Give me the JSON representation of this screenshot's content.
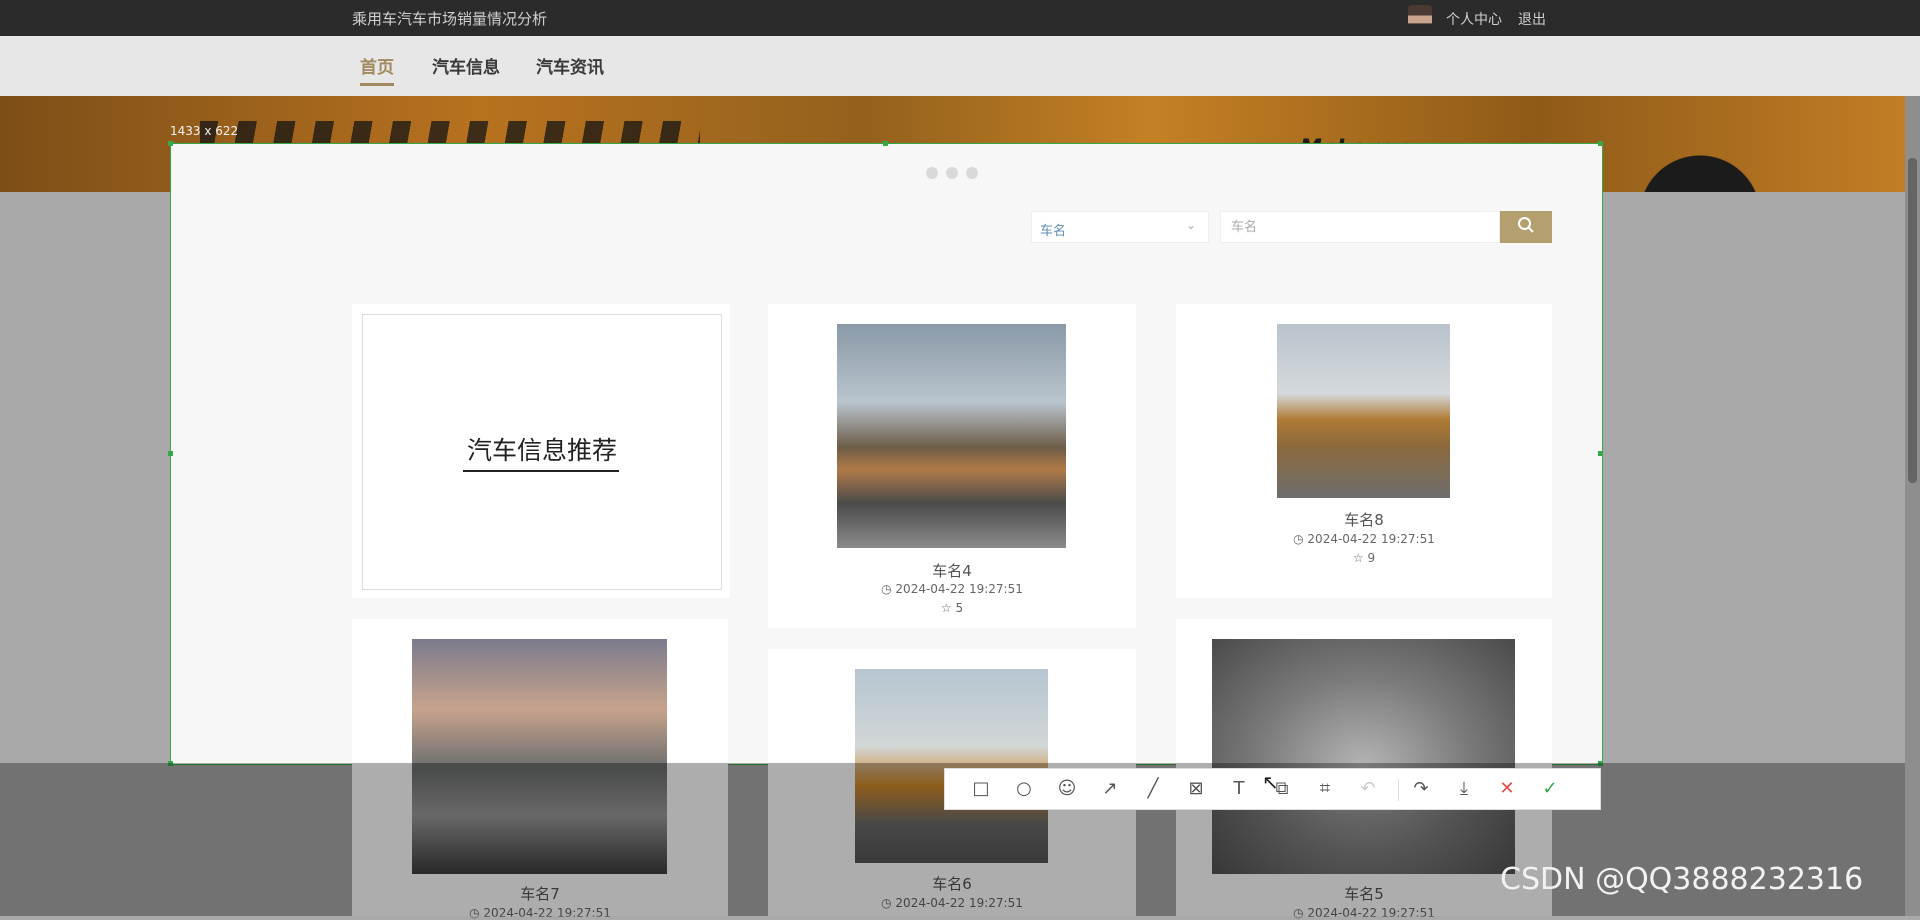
{
  "header": {
    "site_title": "乘用车汽车市场销量情况分析",
    "user_center": "个人中心",
    "logout": "退出"
  },
  "nav": {
    "items": [
      {
        "label": "首页",
        "active": true
      },
      {
        "label": "汽车信息",
        "active": false
      },
      {
        "label": "汽车资讯",
        "active": false
      }
    ]
  },
  "banner": {
    "brand_text": "McLaren"
  },
  "selection": {
    "size_label": "1433 x 622"
  },
  "search": {
    "field_select_value": "车名",
    "input_placeholder": "车名"
  },
  "recommend": {
    "title": "汽车信息推荐"
  },
  "cards": [
    {
      "name": "车名4",
      "time": "2024-04-22 19:27:51",
      "likes": "5"
    },
    {
      "name": "车名8",
      "time": "2024-04-22 19:27:51",
      "likes": "9"
    },
    {
      "name": "车名7",
      "time": "2024-04-22 19:27:51",
      "likes": ""
    },
    {
      "name": "车名6",
      "time": "2024-04-22 19:27:51",
      "likes": ""
    },
    {
      "name": "车名5",
      "time": "2024-04-22 19:27:51",
      "likes": ""
    }
  ],
  "toolbar": {
    "icons": [
      "rectangle-icon",
      "circle-icon",
      "emoji-icon",
      "arrow-icon",
      "line-icon",
      "mosaic-icon",
      "text-icon",
      "pin-icon",
      "ocr-icon",
      "undo-icon",
      "share-icon",
      "download-icon",
      "cancel-icon",
      "confirm-icon"
    ]
  },
  "watermark": "CSDN @QQ3888232316",
  "colors": {
    "accent": "#b3a06e",
    "selection_border": "#36a84a"
  }
}
